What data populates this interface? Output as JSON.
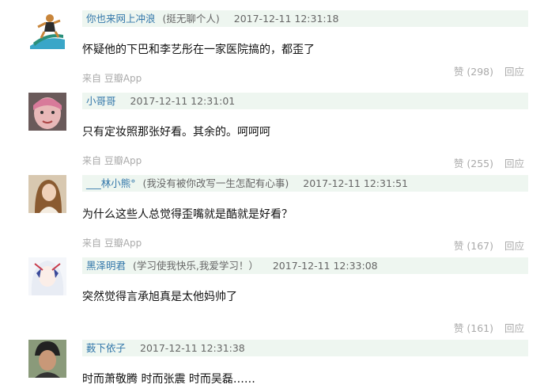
{
  "comments": [
    {
      "avatar": "surfer-emoji-avatar",
      "name": "你也来网上冲浪",
      "signature": "(挺无聊个人)",
      "time": "2017-12-11 12:31:18",
      "text": "怀疑他的下巴和李艺彤在一家医院搞的，都歪了",
      "source_prefix": "来自 ",
      "source_app": "豆瓣App",
      "likes": "赞 (298)",
      "reply": "回应"
    },
    {
      "avatar": "girl-selfie-avatar",
      "name": "小哥哥",
      "signature": "",
      "time": "2017-12-11 12:31:01",
      "text": "只有定妆照那张好看。其余的。呵呵呵",
      "source_prefix": "来自 ",
      "source_app": "豆瓣App",
      "likes": "赞 (255)",
      "reply": "回应"
    },
    {
      "avatar": "woman-portrait-avatar",
      "name": "___林小熊°",
      "signature": "(我没有被你改写一生怎配有心事)",
      "time": "2017-12-11 12:31:51",
      "text": "为什么这些人总觉得歪嘴就是酷就是好看？",
      "source_prefix": "来自 ",
      "source_app": "豆瓣App",
      "likes": "赞 (167)",
      "reply": "回应"
    },
    {
      "avatar": "anime-girl-avatar",
      "name": "黑泽明君",
      "signature": "(学习使我快乐,我爱学习！）",
      "time": "2017-12-11 12:33:08",
      "text": "突然觉得言承旭真是太他妈帅了",
      "source_prefix": "",
      "source_app": "",
      "likes": "赞 (161)",
      "reply": "回应"
    },
    {
      "avatar": "man-portrait-avatar",
      "name": "薮下依子",
      "signature": "",
      "time": "2017-12-11 12:31:38",
      "text": "时而萧敬腾 时而张震 时而吴磊……",
      "source_prefix": "",
      "source_app": "",
      "likes": "",
      "reply": ""
    }
  ]
}
